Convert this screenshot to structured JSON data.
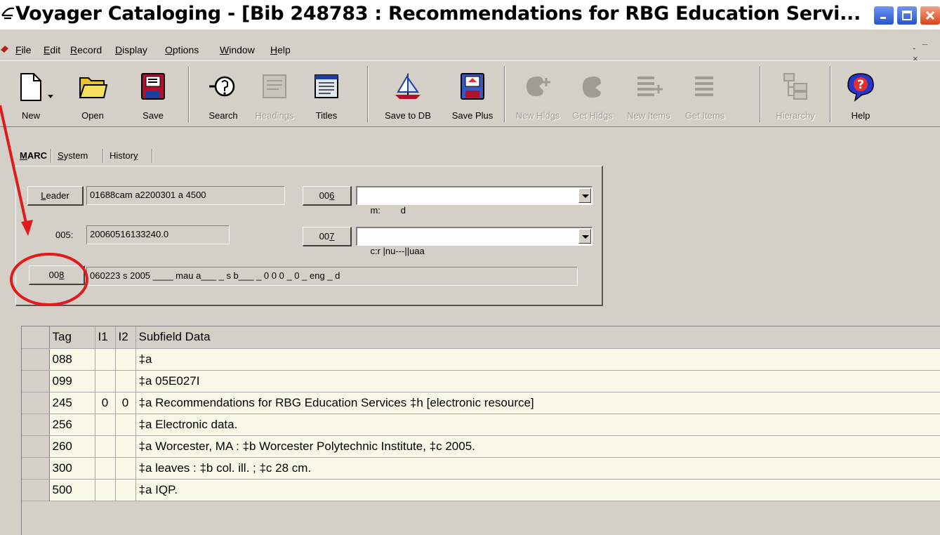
{
  "window": {
    "title": "Voyager Cataloging - [Bib 248783 : Recommendations for RBG Education Servi...",
    "controls": [
      "minimize",
      "maximize",
      "close"
    ]
  },
  "menu": {
    "items": [
      {
        "label": "File",
        "mnemonic": "F"
      },
      {
        "label": "Edit",
        "mnemonic": "E"
      },
      {
        "label": "Record",
        "mnemonic": "R"
      },
      {
        "label": "Display",
        "mnemonic": "D"
      },
      {
        "label": "Options",
        "mnemonic": "O"
      },
      {
        "label": "Window",
        "mnemonic": "W"
      },
      {
        "label": "Help",
        "mnemonic": "H"
      }
    ],
    "mdi_controls": "- ¯ ×"
  },
  "toolbar": {
    "buttons": [
      {
        "id": "new",
        "label": "New",
        "icon": "new-document-icon",
        "enabled": true
      },
      {
        "id": "open",
        "label": "Open",
        "icon": "folder-open-icon",
        "enabled": true
      },
      {
        "id": "save",
        "label": "Save",
        "icon": "floppy-disk-icon",
        "enabled": true
      },
      {
        "id": "search",
        "label": "Search",
        "icon": "search-magnifier-icon",
        "enabled": true
      },
      {
        "id": "headings",
        "label": "Headings",
        "icon": "headings-icon",
        "enabled": false
      },
      {
        "id": "titles",
        "label": "Titles",
        "icon": "titles-list-icon",
        "enabled": true
      },
      {
        "id": "save-to-db",
        "label": "Save to DB",
        "icon": "sailboat-icon",
        "enabled": true
      },
      {
        "id": "save-plus",
        "label": "Save Plus",
        "icon": "floppy-plus-icon",
        "enabled": true
      },
      {
        "id": "new-hldgs",
        "label": "New Hldgs",
        "icon": "new-holdings-icon",
        "enabled": false
      },
      {
        "id": "get-hldgs",
        "label": "Get Hldgs",
        "icon": "get-holdings-icon",
        "enabled": false
      },
      {
        "id": "new-items",
        "label": "New Items",
        "icon": "new-items-icon",
        "enabled": false
      },
      {
        "id": "get-items",
        "label": "Get Items",
        "icon": "get-items-icon",
        "enabled": false
      },
      {
        "id": "hierarchy",
        "label": "Hierarchy",
        "icon": "hierarchy-icon",
        "enabled": false
      },
      {
        "id": "help",
        "label": "Help",
        "icon": "help-question-icon",
        "enabled": true
      }
    ]
  },
  "tabs": [
    {
      "label": "MARC",
      "mnemonic": "M",
      "active": true
    },
    {
      "label": "System",
      "mnemonic": "S",
      "active": false
    },
    {
      "label": "History",
      "mnemonic": "y",
      "active": false
    }
  ],
  "fixed_fields": {
    "leader_button": "Leader",
    "leader_value": "01688cam a2200301 a 4500",
    "f005_label": "005:",
    "f005_value": "20060516133240.0",
    "f006_button": "006",
    "f006_value": "m:        d",
    "f007_button": "007",
    "f007_value": "c:r |nu---||uaa",
    "f008_button": "008",
    "f008_value": "060223 s 2005 ____ mau a___ _ s b___ _ 0 0 0 _ 0 _ eng _ d"
  },
  "grid": {
    "columns": [
      "Tag",
      "I1",
      "I2",
      "Subfield Data"
    ],
    "rows": [
      {
        "tag": "088",
        "i1": "",
        "i2": "",
        "data": "‡a"
      },
      {
        "tag": "099",
        "i1": "",
        "i2": "",
        "data": "‡a 05E027I"
      },
      {
        "tag": "245",
        "i1": "0",
        "i2": "0",
        "data": "‡a Recommendations for RBG Education Services ‡h [electronic resource]"
      },
      {
        "tag": "256",
        "i1": "",
        "i2": "",
        "data": "‡a Electronic data."
      },
      {
        "tag": "260",
        "i1": "",
        "i2": "",
        "data": "‡a Worcester, MA : ‡b Worcester Polytechnic Institute, ‡c 2005."
      },
      {
        "tag": "300",
        "i1": "",
        "i2": "",
        "data": "‡a leaves : ‡b col. ill. ; ‡c 28 cm."
      },
      {
        "tag": "500",
        "i1": "",
        "i2": "",
        "data": "‡a IQP."
      }
    ]
  },
  "colors": {
    "grid_row_bg": "#f7f9e6",
    "chrome_bg": "#d4d0c8",
    "annotation": "#e01b1b"
  }
}
